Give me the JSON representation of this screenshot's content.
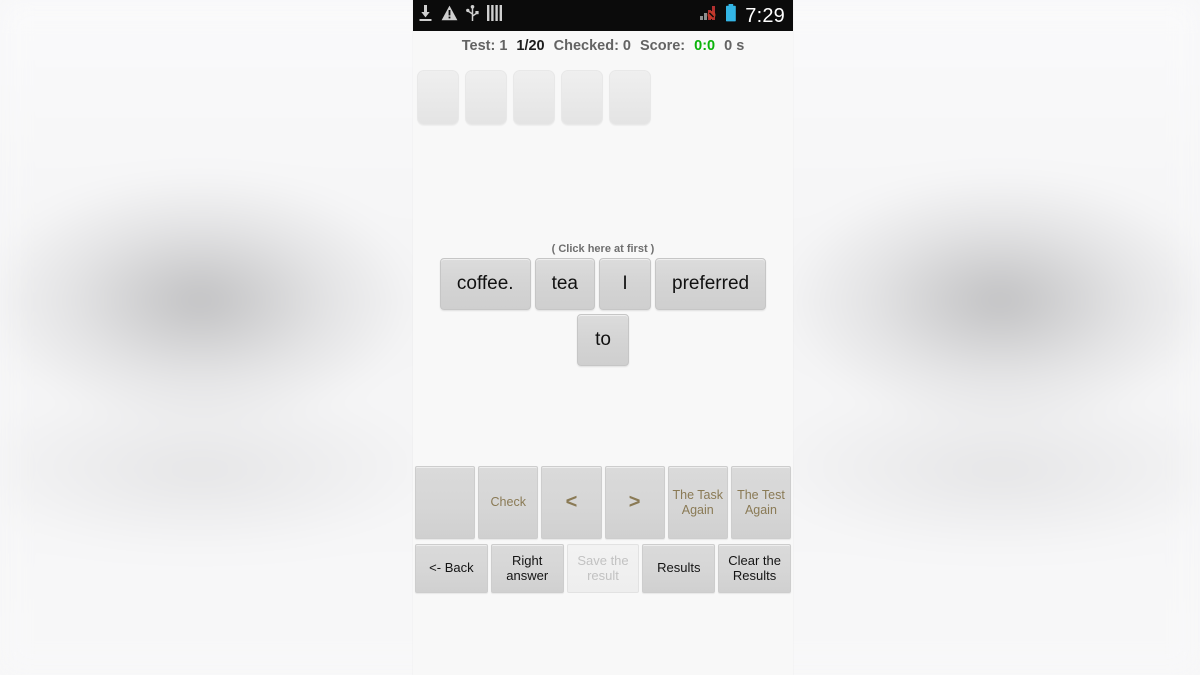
{
  "statusbar": {
    "icons_left": [
      "download-icon",
      "warning-icon",
      "usb-icon",
      "bars-icon"
    ],
    "icons_right": [
      "signal-no-sim-icon",
      "battery-icon"
    ],
    "time": "7:29"
  },
  "infoline": {
    "test_label": "Test: 1",
    "progress": "1/20",
    "checked": "Checked: 0",
    "score_label": "Score:",
    "score_value": "0:0",
    "elapsed": "0 s"
  },
  "slots": {
    "count": 5,
    "values": [
      "",
      "",
      "",
      "",
      ""
    ]
  },
  "hint": "( Click here at first )",
  "tiles": [
    {
      "label": "coffee."
    },
    {
      "label": "tea"
    },
    {
      "label": "I"
    },
    {
      "label": "preferred"
    },
    {
      "label": "to"
    }
  ],
  "controls": {
    "row1": [
      {
        "label": "",
        "name": "blank-button",
        "style": "blank"
      },
      {
        "label": "Check",
        "name": "check-button",
        "style": ""
      },
      {
        "label": "<",
        "name": "previous-button",
        "style": "arrow"
      },
      {
        "label": ">",
        "name": "next-button",
        "style": "arrow"
      },
      {
        "label": "The Task\nAgain",
        "name": "task-again-button",
        "style": ""
      },
      {
        "label": "The Test\nAgain",
        "name": "test-again-button",
        "style": ""
      }
    ],
    "row2": [
      {
        "label": "<- Back",
        "name": "back-button",
        "style": ""
      },
      {
        "label": "Right\nanswer",
        "name": "right-answer-button",
        "style": ""
      },
      {
        "label": "Save the\nresult",
        "name": "save-result-button",
        "style": "disabled"
      },
      {
        "label": "Results",
        "name": "results-button",
        "style": ""
      },
      {
        "label": "Clear the\nResults",
        "name": "clear-results-button",
        "style": ""
      }
    ]
  },
  "colors": {
    "statusbar_bg": "#0b0b0b",
    "screen_bg": "#f8f8f8",
    "tile_bg": "#d6d6d6",
    "score_green": "#0ab30a",
    "row1_text": "#8a7a55",
    "battery_blue": "#33b5e5"
  }
}
